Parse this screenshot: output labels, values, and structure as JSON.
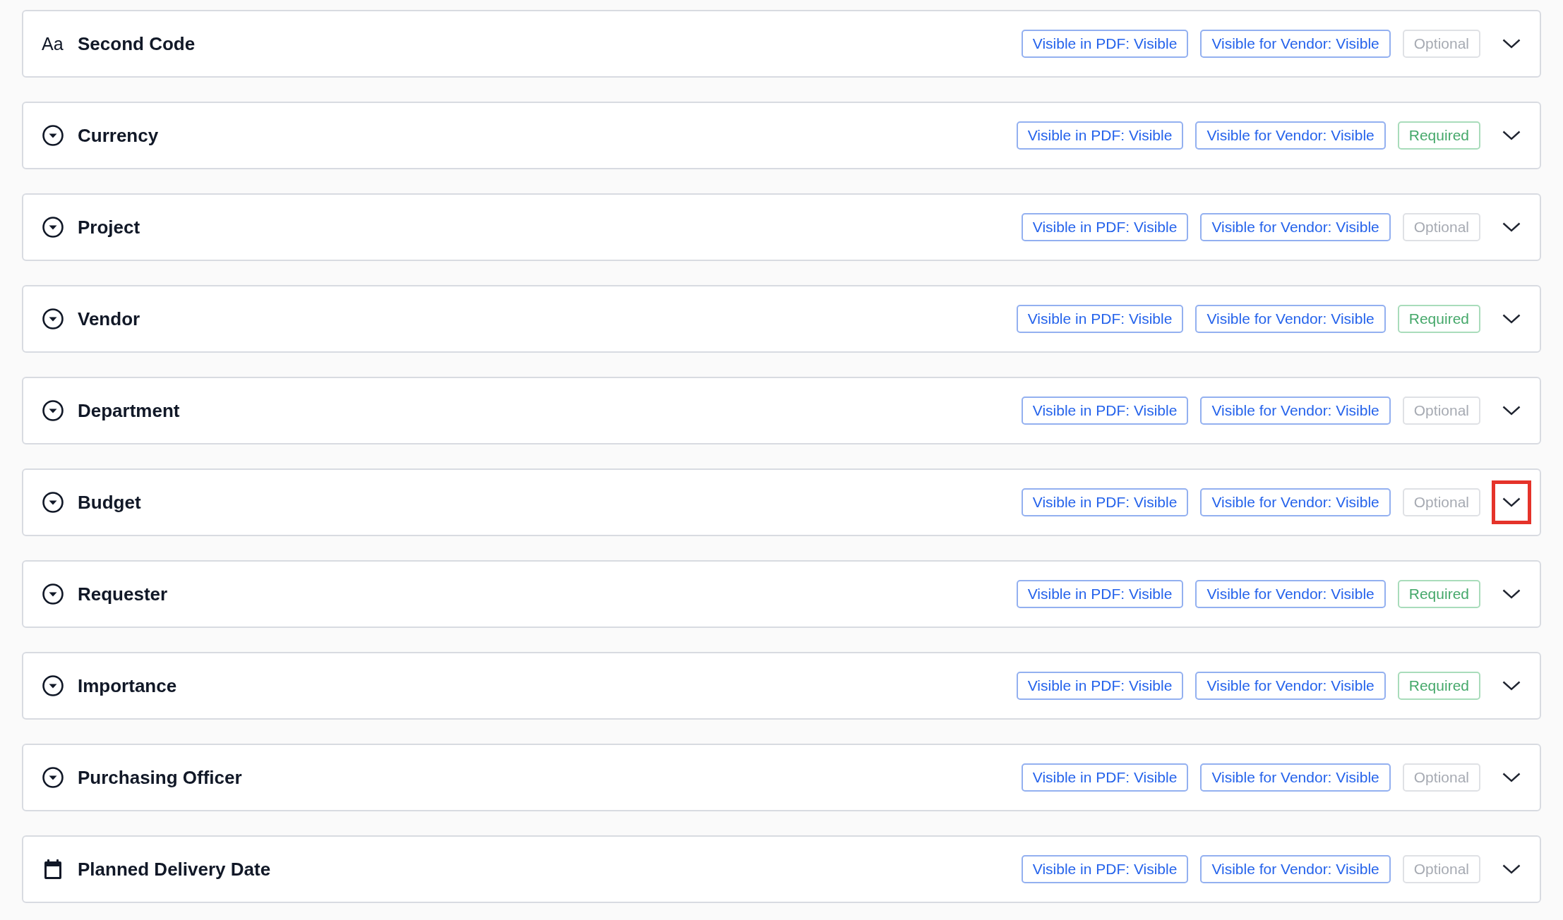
{
  "fields": [
    {
      "kind": "text",
      "icon_label": "Aa",
      "name": "Second Code",
      "pdf": "Visible in PDF: Visible",
      "vendor": "Visible for Vendor: Visible",
      "requirement": "Optional",
      "required": false,
      "highlighted": false
    },
    {
      "kind": "select",
      "name": "Currency",
      "pdf": "Visible in PDF: Visible",
      "vendor": "Visible for Vendor: Visible",
      "requirement": "Required",
      "required": true,
      "highlighted": false
    },
    {
      "kind": "select",
      "name": "Project",
      "pdf": "Visible in PDF: Visible",
      "vendor": "Visible for Vendor: Visible",
      "requirement": "Optional",
      "required": false,
      "highlighted": false
    },
    {
      "kind": "select",
      "name": "Vendor",
      "pdf": "Visible in PDF: Visible",
      "vendor": "Visible for Vendor: Visible",
      "requirement": "Required",
      "required": true,
      "highlighted": false
    },
    {
      "kind": "select",
      "name": "Department",
      "pdf": "Visible in PDF: Visible",
      "vendor": "Visible for Vendor: Visible",
      "requirement": "Optional",
      "required": false,
      "highlighted": false
    },
    {
      "kind": "select",
      "name": "Budget",
      "pdf": "Visible in PDF: Visible",
      "vendor": "Visible for Vendor: Visible",
      "requirement": "Optional",
      "required": false,
      "highlighted": true
    },
    {
      "kind": "select",
      "name": "Requester",
      "pdf": "Visible in PDF: Visible",
      "vendor": "Visible for Vendor: Visible",
      "requirement": "Required",
      "required": true,
      "highlighted": false
    },
    {
      "kind": "select",
      "name": "Importance",
      "pdf": "Visible in PDF: Visible",
      "vendor": "Visible for Vendor: Visible",
      "requirement": "Required",
      "required": true,
      "highlighted": false
    },
    {
      "kind": "select",
      "name": "Purchasing Officer",
      "pdf": "Visible in PDF: Visible",
      "vendor": "Visible for Vendor: Visible",
      "requirement": "Optional",
      "required": false,
      "highlighted": false
    },
    {
      "kind": "date",
      "name": "Planned Delivery Date",
      "pdf": "Visible in PDF: Visible",
      "vendor": "Visible for Vendor: Visible",
      "requirement": "Optional",
      "required": false,
      "highlighted": false
    }
  ]
}
